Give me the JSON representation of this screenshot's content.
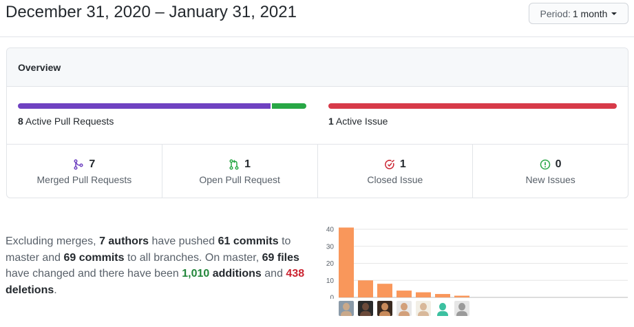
{
  "header": {
    "date_range": "December 31, 2020 – January 31, 2021",
    "period_label": "Period:",
    "period_value": "1 month"
  },
  "overview": {
    "title": "Overview",
    "pull_requests": {
      "count": "8",
      "label": "Active Pull Requests",
      "merged_fraction": 0.875,
      "open_fraction": 0.125
    },
    "issues": {
      "count": "1",
      "label": "Active Issue"
    },
    "stats": [
      {
        "value": "7",
        "label": "Merged Pull Requests",
        "icon": "git-merge-icon",
        "color": "#6f42c1"
      },
      {
        "value": "1",
        "label": "Open Pull Request",
        "icon": "git-pull-request-icon",
        "color": "#28a745"
      },
      {
        "value": "1",
        "label": "Closed Issue",
        "icon": "issue-closed-icon",
        "color": "#cb2431"
      },
      {
        "value": "0",
        "label": "New Issues",
        "icon": "issue-opened-icon",
        "color": "#28a745"
      }
    ]
  },
  "summary": {
    "t1": "Excluding merges, ",
    "authors": "7 authors",
    "t2": " have pushed ",
    "commits_master": "61 commits",
    "t3": " to master and ",
    "commits_all": "69 commits",
    "t4": " to all branches. On master, ",
    "files": "69 files",
    "t5": " have changed and there have been ",
    "additions_num": "1,010",
    "additions_word": " additions",
    "t6": " and ",
    "deletions_num": "438",
    "deletions_word": " deletions",
    "t7": "."
  },
  "chart_data": {
    "type": "bar",
    "categories": [
      "author-1",
      "author-2",
      "author-3",
      "author-4",
      "author-5",
      "author-6",
      "author-7"
    ],
    "values": [
      41,
      10,
      8,
      4,
      3,
      2,
      1
    ],
    "ylim": [
      0,
      40
    ],
    "yticks": [
      0,
      10,
      20,
      30,
      40
    ],
    "bar_color": "#f9975b",
    "grid": true
  },
  "colors": {
    "merged": "#6f42c1",
    "open": "#28a745",
    "issue": "#d73a49"
  }
}
